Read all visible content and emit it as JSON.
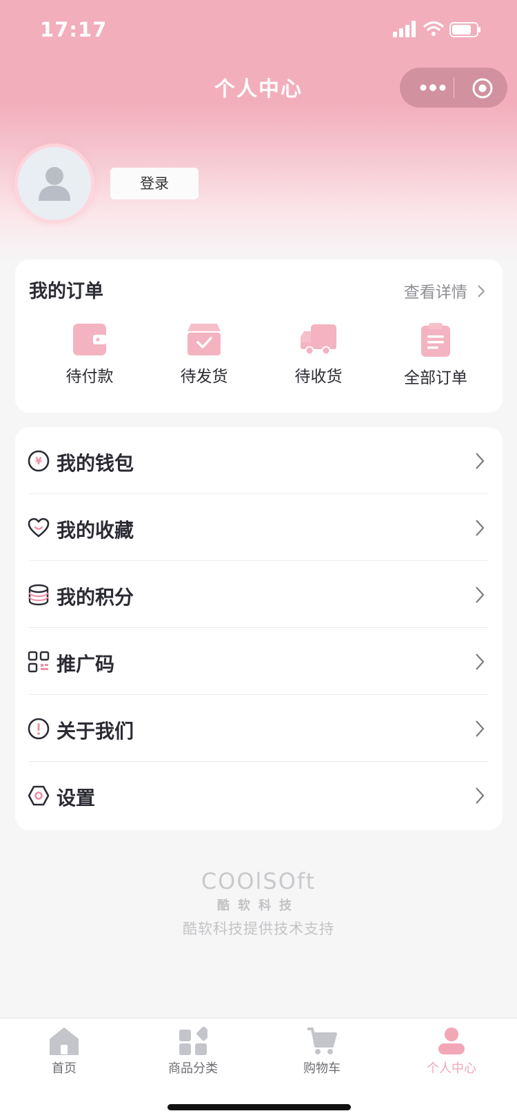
{
  "status_bar": {
    "time": "17:17"
  },
  "header": {
    "title": "个人中心"
  },
  "profile": {
    "login_label": "登录"
  },
  "orders": {
    "title": "我的订单",
    "more_label": "查看详情",
    "items": [
      {
        "label": "待付款",
        "icon": "wallet-icon"
      },
      {
        "label": "待发货",
        "icon": "box-check-icon"
      },
      {
        "label": "待收货",
        "icon": "truck-icon"
      },
      {
        "label": "全部订单",
        "icon": "clipboard-icon"
      }
    ]
  },
  "menu": {
    "items": [
      {
        "label": "我的钱包",
        "icon": "yen-coin-icon"
      },
      {
        "label": "我的收藏",
        "icon": "heart-icon"
      },
      {
        "label": "我的积分",
        "icon": "coins-stack-icon"
      },
      {
        "label": "推广码",
        "icon": "qr-code-icon"
      },
      {
        "label": "关于我们",
        "icon": "info-circle-icon"
      },
      {
        "label": "设置",
        "icon": "hexagon-settings-icon"
      }
    ]
  },
  "footer": {
    "logo_text": "COOlSOft",
    "logo_cn": "酷软科技",
    "support_text": "酷软科技提供技术支持"
  },
  "tabbar": {
    "tabs": [
      {
        "label": "首页",
        "icon": "home-icon"
      },
      {
        "label": "商品分类",
        "icon": "category-icon"
      },
      {
        "label": "购物车",
        "icon": "cart-icon"
      },
      {
        "label": "个人中心",
        "icon": "user-icon"
      }
    ],
    "active": "个人中心"
  },
  "colors": {
    "accent": "#f2a7b6",
    "header_pink": "#f2aebb",
    "text": "#2b2b33"
  }
}
